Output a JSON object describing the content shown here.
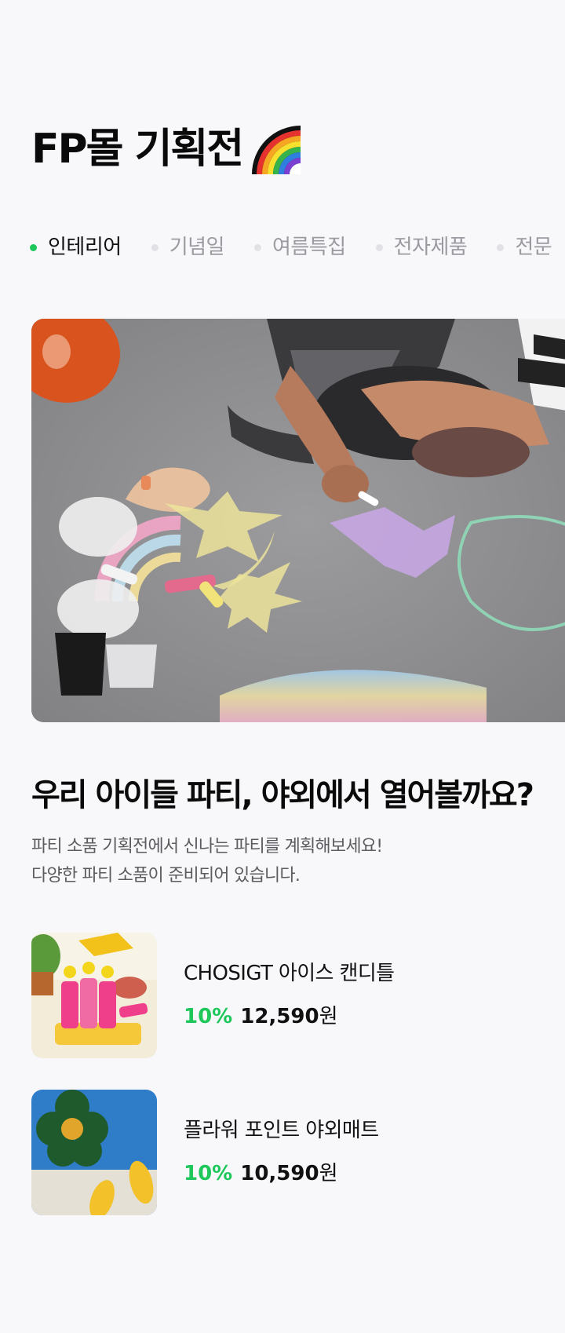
{
  "header": {
    "title": "FP몰 기획전",
    "emoji_icon": "rainbow-icon"
  },
  "tabs": [
    {
      "label": "인테리어",
      "active": true
    },
    {
      "label": "기념일",
      "active": false
    },
    {
      "label": "여름특집",
      "active": false
    },
    {
      "label": "전자제품",
      "active": false
    },
    {
      "label": "전문",
      "active": false
    }
  ],
  "hero": {
    "image": "child-drawing-chalk-rainbow-on-asphalt"
  },
  "promo": {
    "headline": "우리 아이들 파티, 야외에서 열어볼까요?",
    "desc_line1": "파티 소품 기획전에서 신나는 파티를 계획해보세요!",
    "desc_line2": "다양한 파티 소품이 준비되어 있습니다."
  },
  "products": [
    {
      "name": "CHOSIGT 아이스 캔디틀",
      "discount": "10%",
      "price": "12,590",
      "currency": "원",
      "image": "ice-popsicle-molds"
    },
    {
      "name": "플라워 포인트 야외매트",
      "discount": "10%",
      "price": "10,590",
      "currency": "원",
      "image": "flower-mat-sandals"
    }
  ],
  "colors": {
    "accent": "#1ec75a",
    "background": "#f8f8fa",
    "inactive_tab": "#9a9aa0"
  }
}
